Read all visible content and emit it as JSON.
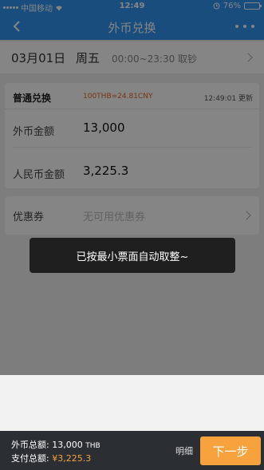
{
  "status_bar": {
    "carrier": "中国移动",
    "time": "12:49",
    "battery": "76%",
    "battery_level": 0.76
  },
  "nav": {
    "title": "外币兑换"
  },
  "date_row": {
    "date": "03月01日",
    "weekday": "周五",
    "hours": "00:00~23:30 取钞"
  },
  "exchange": {
    "header": "普通兑换",
    "rate": "100THB=24.81CNY",
    "updated": "12:49:01 更新",
    "foreign_label": "外币金额",
    "foreign_value": "13,000",
    "rmb_label": "人民币金额",
    "rmb_value": "3,225.3"
  },
  "coupon": {
    "label": "优惠券",
    "value": "无可用优惠券"
  },
  "toast": {
    "message": "已按最小票面自动取整~"
  },
  "bottom_bar": {
    "foreign_total_label": "外币总额:",
    "foreign_total_value": "13,000",
    "foreign_total_unit": "THB",
    "pay_total_label": "支付总额:",
    "pay_total_value": "¥3,225.3",
    "detail": "明细",
    "next": "下一步"
  },
  "colors": {
    "nav_blue": "#2f95f0",
    "accent_orange": "#f7a23c",
    "rate_orange": "#e8641f",
    "bottom_bar": "#2b2e33"
  }
}
